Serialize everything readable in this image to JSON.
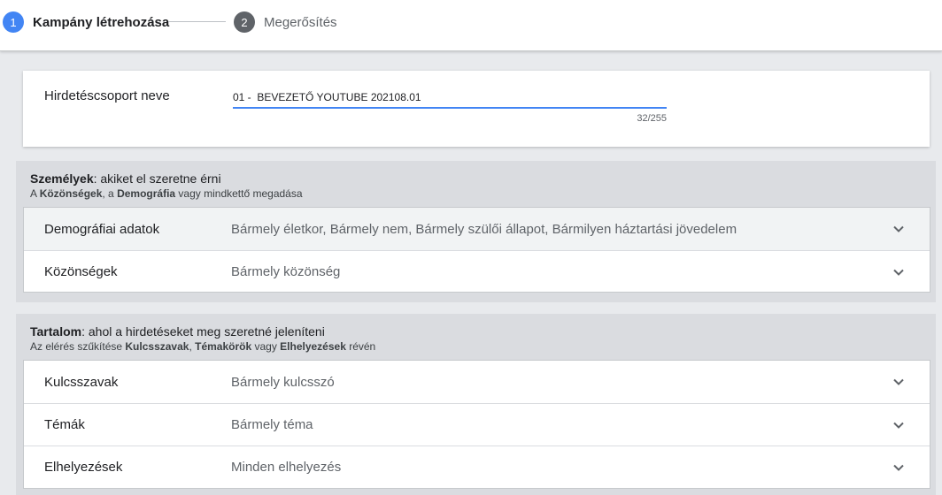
{
  "stepper": {
    "step1": {
      "number": "1",
      "label": "Kampány létrehozása"
    },
    "step2": {
      "number": "2",
      "label": "Megerősítés"
    }
  },
  "adgroup": {
    "label": "Hirdetéscsoport neve",
    "value": "01 -  BEVEZETŐ YOUTUBE 202108.01",
    "counter": "32/255"
  },
  "people": {
    "title_bold": "Személyek",
    "title_rest": ": akiket el szeretne érni",
    "sub_prefix": "A ",
    "sub_b1": "Közönségek",
    "sub_mid": ", a ",
    "sub_b2": "Demográfia",
    "sub_suffix": " vagy mindkettő megadása",
    "rows": [
      {
        "label": "Demográfiai adatok",
        "value": "Bármely életkor, Bármely nem, Bármely szülői állapot, Bármilyen háztartási jövedelem"
      },
      {
        "label": "Közönségek",
        "value": "Bármely közönség"
      }
    ]
  },
  "content": {
    "title_bold": "Tartalom",
    "title_rest": ": ahol a hirdetéseket meg szeretné jeleníteni",
    "sub_prefix": "Az elérés szűkítése ",
    "sub_b1": "Kulcsszavak",
    "sub_mid1": ", ",
    "sub_b2": "Témakörök",
    "sub_mid2": " vagy ",
    "sub_b3": "Elhelyezések",
    "sub_suffix": " révén",
    "rows": [
      {
        "label": "Kulcsszavak",
        "value": "Bármely kulcsszó"
      },
      {
        "label": "Témák",
        "value": "Bármely téma"
      },
      {
        "label": "Elhelyezések",
        "value": "Minden elhelyezés"
      }
    ]
  },
  "icons": {
    "expand": "chevron-down-icon"
  },
  "colors": {
    "accent": "#4285f4",
    "step_inactive": "#5f6368",
    "section_bg": "#dadce0"
  }
}
